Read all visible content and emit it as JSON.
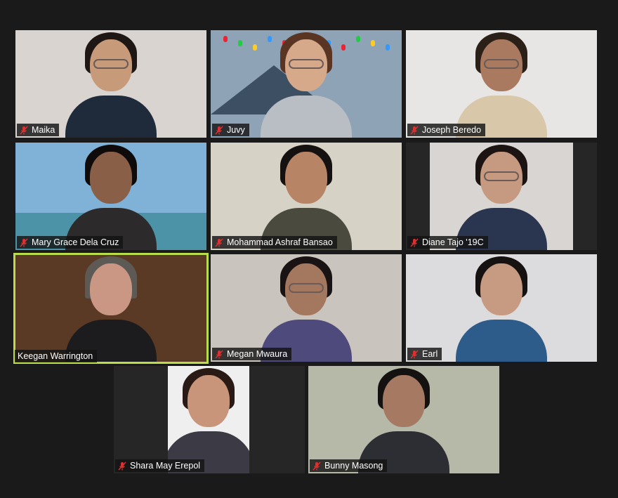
{
  "meeting": {
    "participants": [
      {
        "name": "Maika",
        "muted": true,
        "bg": "#d9d4cf",
        "skin": "#c79a7a",
        "hair": "#1e1714",
        "shirt": "#1f2b3a"
      },
      {
        "name": "Juvy",
        "muted": true,
        "bg": "#8fa3b6",
        "skin": "#d7a98b",
        "hair": "#5a3524",
        "shirt": "#b9bdc4"
      },
      {
        "name": "Joseph Beredo",
        "muted": true,
        "bg": "#e7e6e4",
        "skin": "#a97a5f",
        "hair": "#2b2018",
        "shirt": "#d8c7a8"
      },
      {
        "name": "Mary Grace Dela Cruz",
        "muted": true,
        "bg": "#7fb2d6",
        "skin": "#8a5f48",
        "hair": "#0f0b0a",
        "shirt": "#2c2a2b"
      },
      {
        "name": "Mohammad Ashraf Bansao",
        "muted": true,
        "bg": "#d6d2c6",
        "skin": "#b88466",
        "hair": "#151110",
        "shirt": "#4a4a3f"
      },
      {
        "name": "Diane Tajo '19C",
        "muted": true,
        "bg": "#d8d5d2",
        "skin": "#c69a80",
        "hair": "#1c1412",
        "shirt": "#2a3550"
      },
      {
        "name": "Keegan Warrington",
        "muted": false,
        "active": true,
        "bg": "#5a3a24",
        "skin": "#c99783",
        "hair": "#5d5a55",
        "shirt": "#1c1c1e"
      },
      {
        "name": "Megan Mwaura",
        "muted": true,
        "bg": "#c9c4bd",
        "skin": "#a4775f",
        "hair": "#1a1313",
        "shirt": "#4e4a7c"
      },
      {
        "name": "Earl",
        "muted": true,
        "bg": "#dcdcde",
        "skin": "#c79b82",
        "hair": "#161212",
        "shirt": "#2e5c8a"
      },
      {
        "name": "Shara May Erepol",
        "muted": true,
        "bg": "#efefef",
        "skin": "#c8957a",
        "hair": "#2a1a16",
        "shirt": "#3c3a44"
      },
      {
        "name": "Bunny Masong",
        "muted": true,
        "bg": "#b6b9a8",
        "skin": "#a67a62",
        "hair": "#141111",
        "shirt": "#2c2e33"
      }
    ]
  },
  "colors": {
    "active_speaker": "#b9dc4a",
    "muted_mic": "#e02f2f"
  }
}
